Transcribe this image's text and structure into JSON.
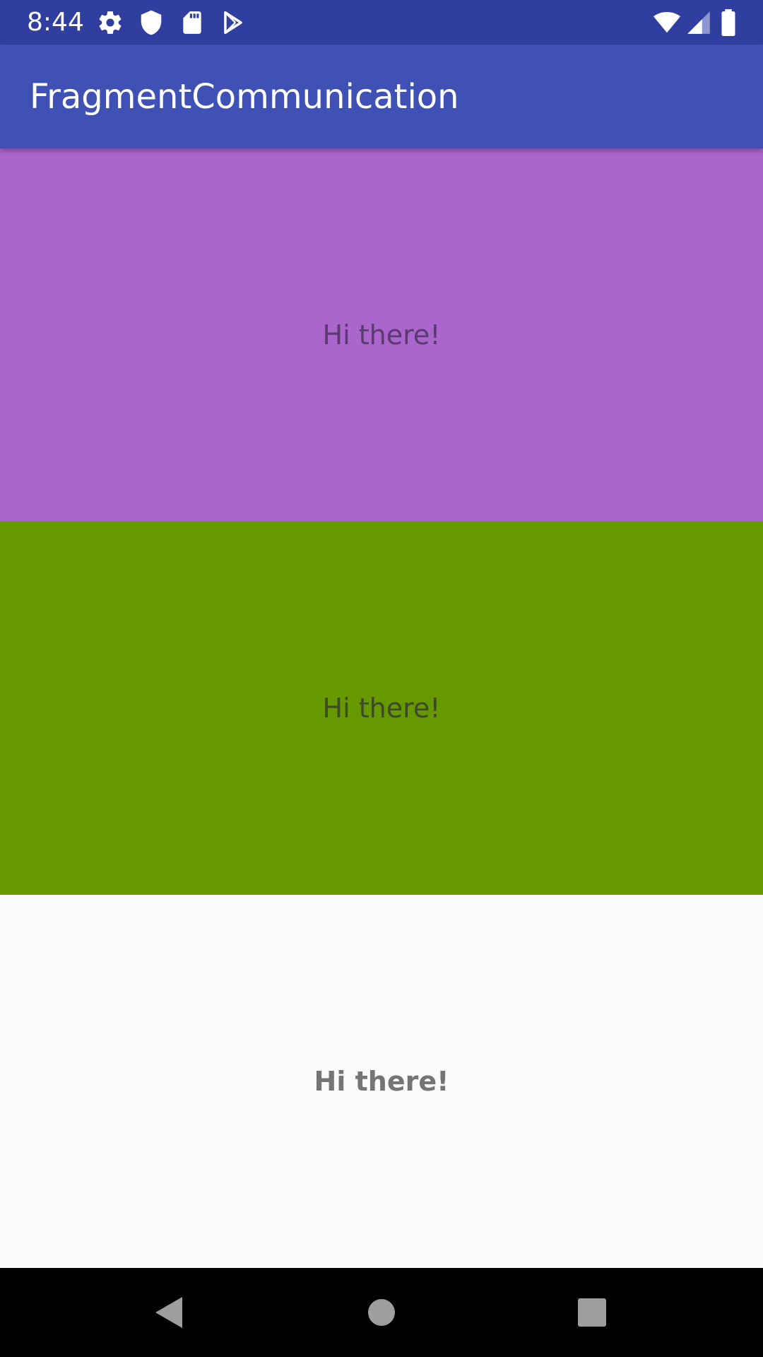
{
  "status_bar": {
    "time": "8:44",
    "background": "#303f9f",
    "left_icons": [
      "settings-icon",
      "shield-icon",
      "sd-card-icon",
      "play-store-icon"
    ],
    "right_icons": [
      "wifi-icon",
      "cellular-signal-icon",
      "battery-icon"
    ]
  },
  "app_bar": {
    "title": "FragmentCommunication",
    "background": "#3f51b5"
  },
  "fragments": [
    {
      "text": "Hi there!",
      "background": "#aa66cc"
    },
    {
      "text": "Hi there!",
      "background": "#669900"
    },
    {
      "text": "Hi there!",
      "background": "#fafafa"
    }
  ],
  "nav_bar": {
    "buttons": [
      "back-icon",
      "home-icon",
      "recents-icon"
    ]
  }
}
